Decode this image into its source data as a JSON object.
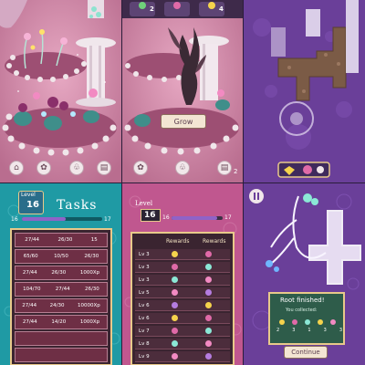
{
  "panel_garden": {
    "nav_icons": [
      "shop-icon",
      "gear-icon",
      "sprout-icon",
      "book-icon"
    ]
  },
  "panel_grow": {
    "top_counts": [
      "2",
      "4"
    ],
    "grow_button": "Grow",
    "corner_badge": "2",
    "nav_icons": [
      "gear-icon",
      "sprout-icon",
      "book-icon"
    ]
  },
  "panel_tasks": {
    "level_label": "Level",
    "level_value": "16",
    "title": "Tasks",
    "progress_left": "16",
    "progress_right": "17",
    "progress_fraction": 0.55,
    "rows": [
      [
        "27/44",
        "26/30",
        "15"
      ],
      [
        "65/60",
        "10/50",
        "26/30"
      ],
      [
        "27/44",
        "26/30",
        "1000Xp"
      ],
      [
        "104/70",
        "27/44",
        "26/30"
      ],
      [
        "27/44",
        "24/30",
        "10000Xp"
      ],
      [
        "27/44",
        "14/20",
        "1000Xp"
      ],
      [
        "",
        "",
        ""
      ],
      [
        "",
        "",
        ""
      ]
    ]
  },
  "panel_rewards": {
    "level_label": "Level",
    "level_value": "16",
    "progress_left": "16",
    "progress_right": "17",
    "progress_fraction": 0.9,
    "header_rewards_1": "Rewards",
    "header_rewards_2": "Rewards",
    "levels": [
      "Lv 3",
      "Lv 3",
      "Lv 3",
      "Lv 5",
      "Lv 6",
      "Lv 6",
      "Lv 7",
      "Lv 8",
      "Lv 9"
    ]
  },
  "panel_root": {
    "root_finished": "Root finished!",
    "you_collected": "You collected:",
    "collected_counts": [
      "2",
      "3",
      "1",
      "3",
      "3"
    ],
    "continue_button": "Continue"
  },
  "colors": {
    "pink_bg": "#c98aa6",
    "purple_bg": "#6a3f99",
    "teal_bg": "#1f9aa4",
    "magenta_bg": "#c0578f",
    "gold_frame": "#e8c98a"
  }
}
